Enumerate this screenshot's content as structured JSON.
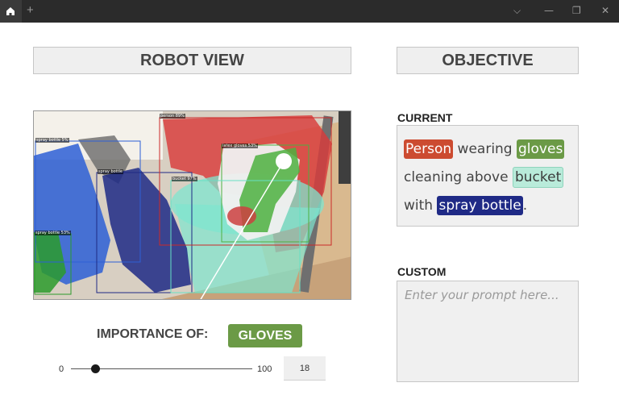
{
  "titlebar": {
    "new_tab": "+",
    "controls": {
      "dropdown": "⌵",
      "minimize": "—",
      "restore": "❐",
      "close": "✕"
    }
  },
  "robot_view": {
    "header": "ROBOT VIEW",
    "detections": [
      {
        "label": "person 89%",
        "color": "#cc2a2a"
      },
      {
        "label": "spray bottle 5%",
        "color": "#2d5fd6"
      },
      {
        "label": "spray bottle 53%",
        "color": "#2b9b2b"
      },
      {
        "label": "spray bottle",
        "color": "#1f2a86"
      },
      {
        "label": "latex gloves 53%",
        "color": "#4db040"
      },
      {
        "label": "bucket 97%",
        "color": "#67e0c4"
      }
    ]
  },
  "importance": {
    "label": "IMPORTANCE OF:",
    "target": "GLOVES",
    "target_color": "#6b9a46",
    "slider": {
      "min": "0",
      "max": "100",
      "value": "18"
    }
  },
  "objective": {
    "header": "OBJECTIVE",
    "current_title": "CURRENT",
    "current_text": [
      {
        "text": "Person",
        "highlight": "person",
        "color": "#cc4b30"
      },
      {
        "text": " wearing ",
        "highlight": null
      },
      {
        "text": "gloves",
        "highlight": "gloves",
        "color": "#6b9a46"
      },
      {
        "text": " cleaning above ",
        "highlight": null
      },
      {
        "text": "bucket",
        "highlight": "bucket",
        "color": "#b9ebda"
      },
      {
        "text": " with ",
        "highlight": null
      },
      {
        "text": "spray bottle",
        "highlight": "spray",
        "color": "#1f2a86"
      },
      {
        "text": ".",
        "highlight": null
      }
    ],
    "custom_title": "CUSTOM",
    "custom_placeholder": "Enter your prompt here..."
  }
}
